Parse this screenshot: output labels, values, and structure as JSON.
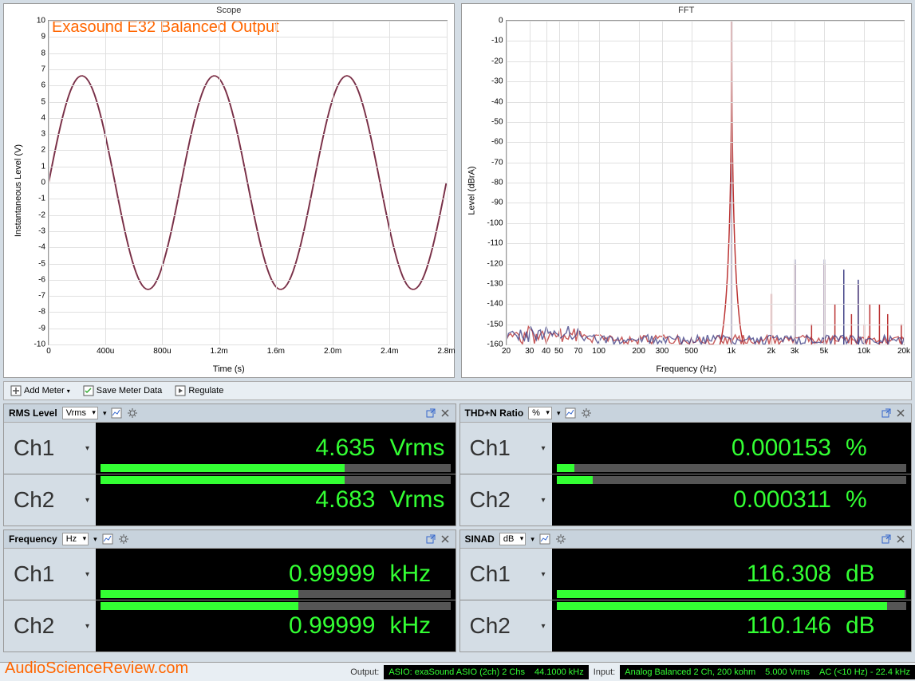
{
  "annotation": "Exasound E32 Balanced Output",
  "watermark": "AudioScienceReview.com",
  "scope": {
    "title": "Scope",
    "ylabel": "Instantaneous Level (V)",
    "xlabel": "Time (s)",
    "y_ticks": [
      "10",
      "9",
      "8",
      "7",
      "6",
      "5",
      "4",
      "3",
      "2",
      "1",
      "0",
      "-1",
      "-2",
      "-3",
      "-4",
      "-5",
      "-6",
      "-7",
      "-8",
      "-9",
      "-10"
    ],
    "x_ticks": [
      "0",
      "400u",
      "800u",
      "1.2m",
      "1.6m",
      "2.0m",
      "2.4m",
      "2.8m"
    ]
  },
  "fft": {
    "title": "FFT",
    "ylabel": "Level (dBrA)",
    "xlabel": "Frequency (Hz)",
    "y_ticks": [
      "0",
      "-10",
      "-20",
      "-30",
      "-40",
      "-50",
      "-60",
      "-70",
      "-80",
      "-90",
      "-100",
      "-110",
      "-120",
      "-130",
      "-140",
      "-150",
      "-160"
    ],
    "x_ticks": [
      "20",
      "30",
      "40",
      "50",
      "70",
      "100",
      "200",
      "300",
      "500",
      "1k",
      "2k",
      "3k",
      "5k",
      "10k",
      "20k"
    ]
  },
  "toolbar": {
    "add_meter": "Add Meter",
    "save_meter": "Save Meter Data",
    "regulate": "Regulate"
  },
  "meters": {
    "rms": {
      "title": "RMS Level",
      "unit": "Vrms",
      "ch1": {
        "label": "Ch1",
        "value": "4.635",
        "unit": "Vrms",
        "bar_pct": 68
      },
      "ch2": {
        "label": "Ch2",
        "value": "4.683",
        "unit": "Vrms",
        "bar_pct": 68
      }
    },
    "thdn": {
      "title": "THD+N Ratio",
      "unit": "%",
      "ch1": {
        "label": "Ch1",
        "value": "0.000153",
        "unit": "%",
        "bar_pct": 5
      },
      "ch2": {
        "label": "Ch2",
        "value": "0.000311",
        "unit": "%",
        "bar_pct": 10
      }
    },
    "freq": {
      "title": "Frequency",
      "unit": "Hz",
      "ch1": {
        "label": "Ch1",
        "value": "0.99999",
        "unit": "kHz",
        "bar_pct": 55
      },
      "ch2": {
        "label": "Ch2",
        "value": "0.99999",
        "unit": "kHz",
        "bar_pct": 55
      }
    },
    "sinad": {
      "title": "SINAD",
      "unit": "dB",
      "ch1": {
        "label": "Ch1",
        "value": "116.308",
        "unit": "dB",
        "bar_pct": 97
      },
      "ch2": {
        "label": "Ch2",
        "value": "110.146",
        "unit": "dB",
        "bar_pct": 92
      }
    }
  },
  "status": {
    "output_label": "Output:",
    "output_val": "ASIO: exaSound ASIO (2ch) 2 Chs",
    "output_rate": "44.1000 kHz",
    "input_label": "Input:",
    "input_val": "Analog Balanced 2 Ch, 200 kohm",
    "input_level": "5.000 Vrms",
    "input_bw": "AC (<10 Hz) - 22.4 kHz"
  },
  "chart_data": [
    {
      "type": "line",
      "title": "Scope",
      "xlabel": "Time (s)",
      "ylabel": "Instantaneous Level (V)",
      "xlim": [
        0,
        0.003
      ],
      "ylim": [
        -10,
        10
      ],
      "series": [
        {
          "name": "Ch1",
          "amplitude": 6.6,
          "frequency_hz": 1000,
          "waveform": "sine"
        },
        {
          "name": "Ch2",
          "amplitude": 6.6,
          "frequency_hz": 1000,
          "waveform": "sine"
        }
      ]
    },
    {
      "type": "line",
      "title": "FFT",
      "xlabel": "Frequency (Hz)",
      "ylabel": "Level (dBrA)",
      "xscale": "log",
      "xlim": [
        20,
        20000
      ],
      "ylim": [
        -160,
        0
      ],
      "series": [
        {
          "name": "Ch1",
          "noise_floor_db": -158,
          "peaks": [
            {
              "freq": 1000,
              "level": 0
            },
            {
              "freq": 2000,
              "level": -135
            },
            {
              "freq": 3000,
              "level": -120
            },
            {
              "freq": 4000,
              "level": -150
            },
            {
              "freq": 5000,
              "level": -120
            },
            {
              "freq": 6000,
              "level": -140
            },
            {
              "freq": 7000,
              "level": -125
            },
            {
              "freq": 8000,
              "level": -145
            },
            {
              "freq": 9000,
              "level": -130
            },
            {
              "freq": 10000,
              "level": -150
            },
            {
              "freq": 11000,
              "level": -140
            },
            {
              "freq": 13000,
              "level": -140
            },
            {
              "freq": 15000,
              "level": -145
            },
            {
              "freq": 19000,
              "level": -150
            }
          ]
        },
        {
          "name": "Ch2",
          "noise_floor_db": -158,
          "peaks": [
            {
              "freq": 1000,
              "level": 0
            },
            {
              "freq": 3000,
              "level": -118
            },
            {
              "freq": 5000,
              "level": -118
            },
            {
              "freq": 7000,
              "level": -123
            },
            {
              "freq": 9000,
              "level": -128
            }
          ]
        }
      ]
    }
  ]
}
